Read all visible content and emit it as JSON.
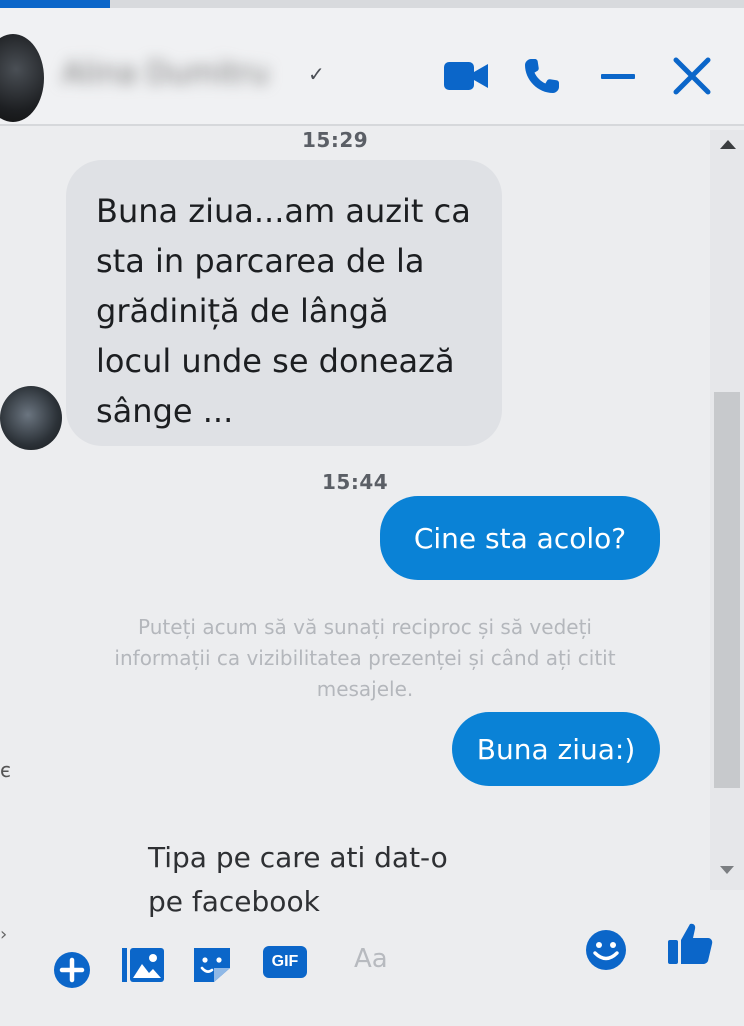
{
  "header": {
    "contact_name": "Alina Dumitru",
    "verified_mark": "✓",
    "icons": [
      "video-camera-icon",
      "phone-icon",
      "minimize-icon",
      "close-icon"
    ]
  },
  "messages": [
    {
      "type": "timestamp",
      "text": "15:29"
    },
    {
      "type": "incoming",
      "lines": [
        "Buna ziua...am auzit ca",
        "sta in parcarea de la",
        "grădiniță de lângă",
        "locul unde se donează",
        "sânge ..."
      ]
    },
    {
      "type": "timestamp",
      "text": "15:44"
    },
    {
      "type": "outgoing",
      "text": "Cine sta acolo?"
    },
    {
      "type": "system",
      "lines": [
        "Puteți acum să vă sunați reciproc și să vedeți",
        "informații ca vizibilitatea prezenței și când ați citit",
        "mesajele."
      ]
    },
    {
      "type": "outgoing",
      "text": "Buna ziua:)"
    }
  ],
  "side_mark": "є",
  "composer": {
    "lines": [
      "Tipa pe  care ati dat-o",
      "pe facebook"
    ],
    "placeholder": "Aa"
  },
  "bottom_icons": [
    "plus-icon",
    "photo-icon",
    "sticker-icon",
    "gif-icon",
    "emoji-icon",
    "thumbs-up-icon"
  ],
  "gif_label": "GIF",
  "colors": {
    "accent": "#0a82d6",
    "incoming_bubble": "#dfe1e5",
    "icon_blue": "#0b66c9"
  }
}
